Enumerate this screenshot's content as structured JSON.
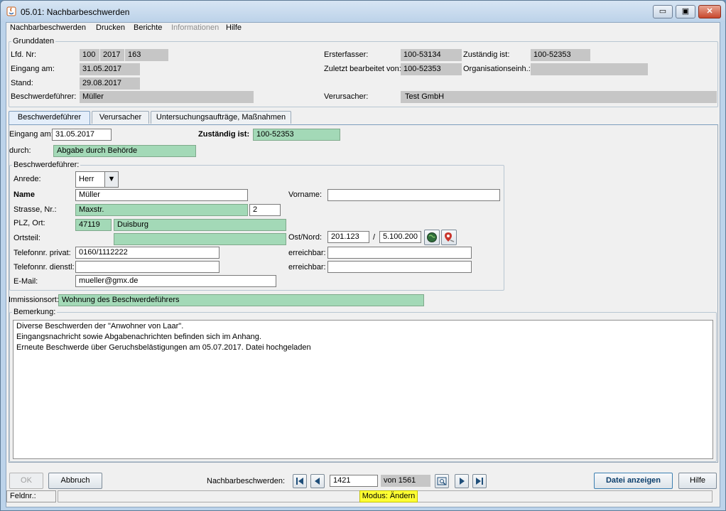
{
  "window": {
    "title": "05.01: Nachbarbeschwerden",
    "controls": {
      "minimize": "▭",
      "maximize": "▣",
      "close": "✕"
    }
  },
  "menu": [
    "Nachbarbeschwerden",
    "Drucken",
    "Berichte",
    "Informationen",
    "Hilfe"
  ],
  "grunddaten": {
    "legend": "Grunddaten",
    "lfd_nr_label": "Lfd. Nr:",
    "lfd_nr": [
      "100",
      "2017",
      "163"
    ],
    "eingang_label": "Eingang am:",
    "eingang": "31.05.2017",
    "stand_label": "Stand:",
    "stand": "29.08.2017",
    "beschwerdefuehrer_label": "Beschwerdeführer:",
    "beschwerdefuehrer": "Müller",
    "ersterfasser_label": "Ersterfasser:",
    "ersterfasser": "100-53134",
    "zustaendig_label": "Zuständig ist:",
    "zustaendig": "100-52353",
    "zuletzt_label": "Zuletzt bearbeitet von:",
    "zuletzt": "100-52353",
    "organisation_label": "Organisationseinh.:",
    "organisation": "",
    "verursacher_label": "Verursacher:",
    "verursacher": "Test GmbH"
  },
  "tabs": [
    "Beschwerdeführer",
    "Verursacher",
    "Untersuchungsaufträge, Maßnahmen"
  ],
  "form": {
    "eingang_label": "Eingang am:",
    "eingang": "31.05.2017",
    "zustaendig_label": "Zuständig ist:",
    "zustaendig": "100-52353",
    "durch_label": "durch:",
    "durch": "Abgabe durch Behörde",
    "bf_legend": "Beschwerdeführer:",
    "anrede_label": "Anrede:",
    "anrede": "Herr",
    "name_label": "Name",
    "name": "Müller",
    "vorname_label": "Vorname:",
    "vorname": "",
    "strasse_label": "Strasse, Nr.:",
    "strasse": "Maxstr.",
    "hausnr": "2",
    "plz_label": "PLZ, Ort:",
    "plz": "47119",
    "ort": "Duisburg",
    "ortsteil_label": "Ortsteil:",
    "ortsteil": "",
    "ostnord_label": "Ost/Nord:",
    "ost": "201.123",
    "slash": "/",
    "nord": "5.100.200",
    "tel_privat_label": "Telefonnr. privat:",
    "tel_privat": "0160/1112222",
    "erreichbar_label": "erreichbar:",
    "erreichbar1": "",
    "tel_dienst_label": "Telefonnr. dienstl:",
    "tel_dienst": "",
    "erreichbar2": "",
    "email_label": "E-Mail:",
    "email": "mueller@gmx.de",
    "immissionsort_label": "Immissionsort:",
    "immissionsort": "Wohnung des Beschwerdeführers",
    "bemerkung_legend": "Bemerkung:",
    "bemerkung": [
      "Diverse Beschwerden der \"Anwohner von Laar\".",
      "Eingangsnachricht sowie Abgabenachrichten befinden sich im Anhang.",
      "Erneute Beschwerde über Geruchsbelästigungen am 05.07.2017. Datei hochgeladen"
    ]
  },
  "footer": {
    "ok": "OK",
    "abbruch": "Abbruch",
    "nav_label": "Nachbarbeschwerden:",
    "record": "1421",
    "of": "von 1561",
    "datei": "Datei anzeigen",
    "hilfe": "Hilfe"
  },
  "status": {
    "feldnr": "Feldnr.:",
    "modus": "Modus: Ändern"
  },
  "colors": {
    "readonly": "#c6c6c6",
    "required_field": "#a3d9b7",
    "modus_highlight": "#ffff33"
  }
}
